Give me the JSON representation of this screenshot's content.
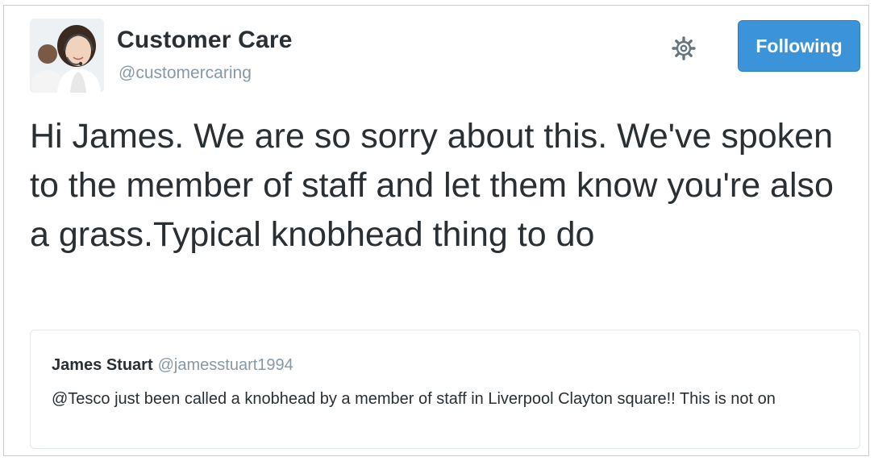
{
  "tweet": {
    "author": {
      "display_name": "Customer Care",
      "handle": "@customercaring",
      "avatar_icon": "customer-service-agent-avatar"
    },
    "text": "Hi James. We are so sorry about this. We've spoken to the member of staff and let them know you're also a grass.Typical knobhead thing to do",
    "actions": {
      "settings_icon": "gear-icon",
      "follow_label": "Following"
    }
  },
  "quoted_tweet": {
    "display_name": "James Stuart",
    "handle": "@jamesstuart1994",
    "text": "@Tesco just been called a knobhead by a member of staff in Liverpool Clayton square!! This is not on"
  },
  "colors": {
    "follow_button": "#3b94d9",
    "text_primary": "#292f33",
    "text_secondary": "#8899a6",
    "border": "#e1e8ed"
  }
}
